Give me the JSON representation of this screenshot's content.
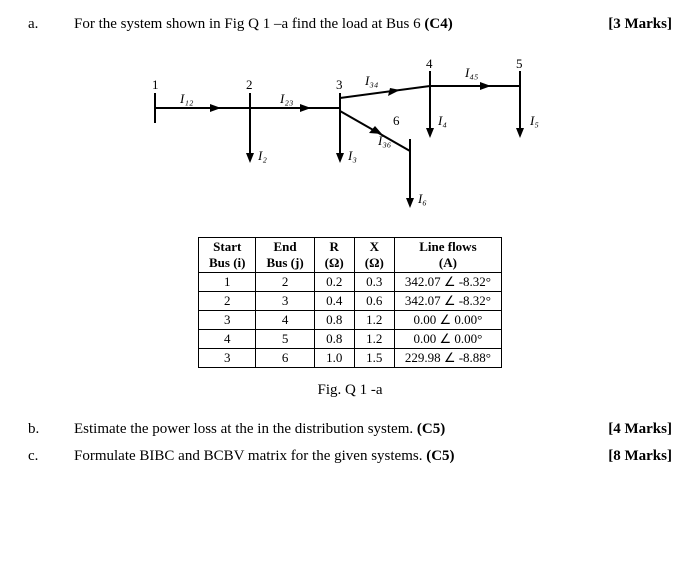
{
  "a": {
    "label": "a.",
    "text_pre": "For the system shown  in Fig Q 1 –a find the load at Bus 6 ",
    "text_bold": "(C4)",
    "marks": "[3 Marks]"
  },
  "diagram": {
    "nodes": {
      "n1": "1",
      "n2": "2",
      "n3": "3",
      "n4": "4",
      "n5": "5",
      "n6": "6"
    },
    "currents": {
      "I12": "I₁₂",
      "I23": "I₂₃",
      "I34": "I₃₄",
      "I45": "I₄₅",
      "I36": "I₃₆",
      "I2": "I₂",
      "I3": "I₃",
      "I4": "I₄",
      "I5": "I₅",
      "I6": "I₆"
    }
  },
  "table": {
    "headers": {
      "start_a": "Start",
      "start_b": "Bus (i)",
      "end_a": "End",
      "end_b": "Bus (j)",
      "r_a": "R",
      "r_b": "(Ω)",
      "x_a": "X",
      "x_b": "(Ω)",
      "lf_a": "Line flows",
      "lf_b": "(A)"
    },
    "rows": [
      {
        "i": "1",
        "j": "2",
        "r": "0.2",
        "x": "0.3",
        "lf": "342.07 ∠ -8.32°"
      },
      {
        "i": "2",
        "j": "3",
        "r": "0.4",
        "x": "0.6",
        "lf": "342.07 ∠ -8.32°"
      },
      {
        "i": "3",
        "j": "4",
        "r": "0.8",
        "x": "1.2",
        "lf": "0.00 ∠  0.00°"
      },
      {
        "i": "4",
        "j": "5",
        "r": "0.8",
        "x": "1.2",
        "lf": "0.00 ∠  0.00°"
      },
      {
        "i": "3",
        "j": "6",
        "r": "1.0",
        "x": "1.5",
        "lf": "229.98 ∠ -8.88°"
      }
    ]
  },
  "figcap": "Fig. Q 1 -a",
  "b": {
    "label": "b.",
    "text_pre": "Estimate  the power loss at the in the distribution system. ",
    "text_bold": "(C5)",
    "marks": "[4 Marks]"
  },
  "c": {
    "label": "c.",
    "text_pre": "Formulate  BIBC and BCBV matrix for the given systems.  ",
    "text_bold": "(C5)",
    "marks": "[8 Marks]"
  },
  "chart_data": {
    "type": "table",
    "title": "Line parameters and flows",
    "columns": [
      "Start Bus (i)",
      "End Bus (j)",
      "R (Ω)",
      "X (Ω)",
      "Line flows (A)"
    ],
    "rows": [
      [
        1,
        2,
        0.2,
        0.3,
        "342.07 ∠ -8.32°"
      ],
      [
        2,
        3,
        0.4,
        0.6,
        "342.07 ∠ -8.32°"
      ],
      [
        3,
        4,
        0.8,
        1.2,
        "0.00 ∠ 0.00°"
      ],
      [
        4,
        5,
        0.8,
        1.2,
        "0.00 ∠ 0.00°"
      ],
      [
        3,
        6,
        1.0,
        1.5,
        "229.98 ∠ -8.88°"
      ]
    ]
  }
}
